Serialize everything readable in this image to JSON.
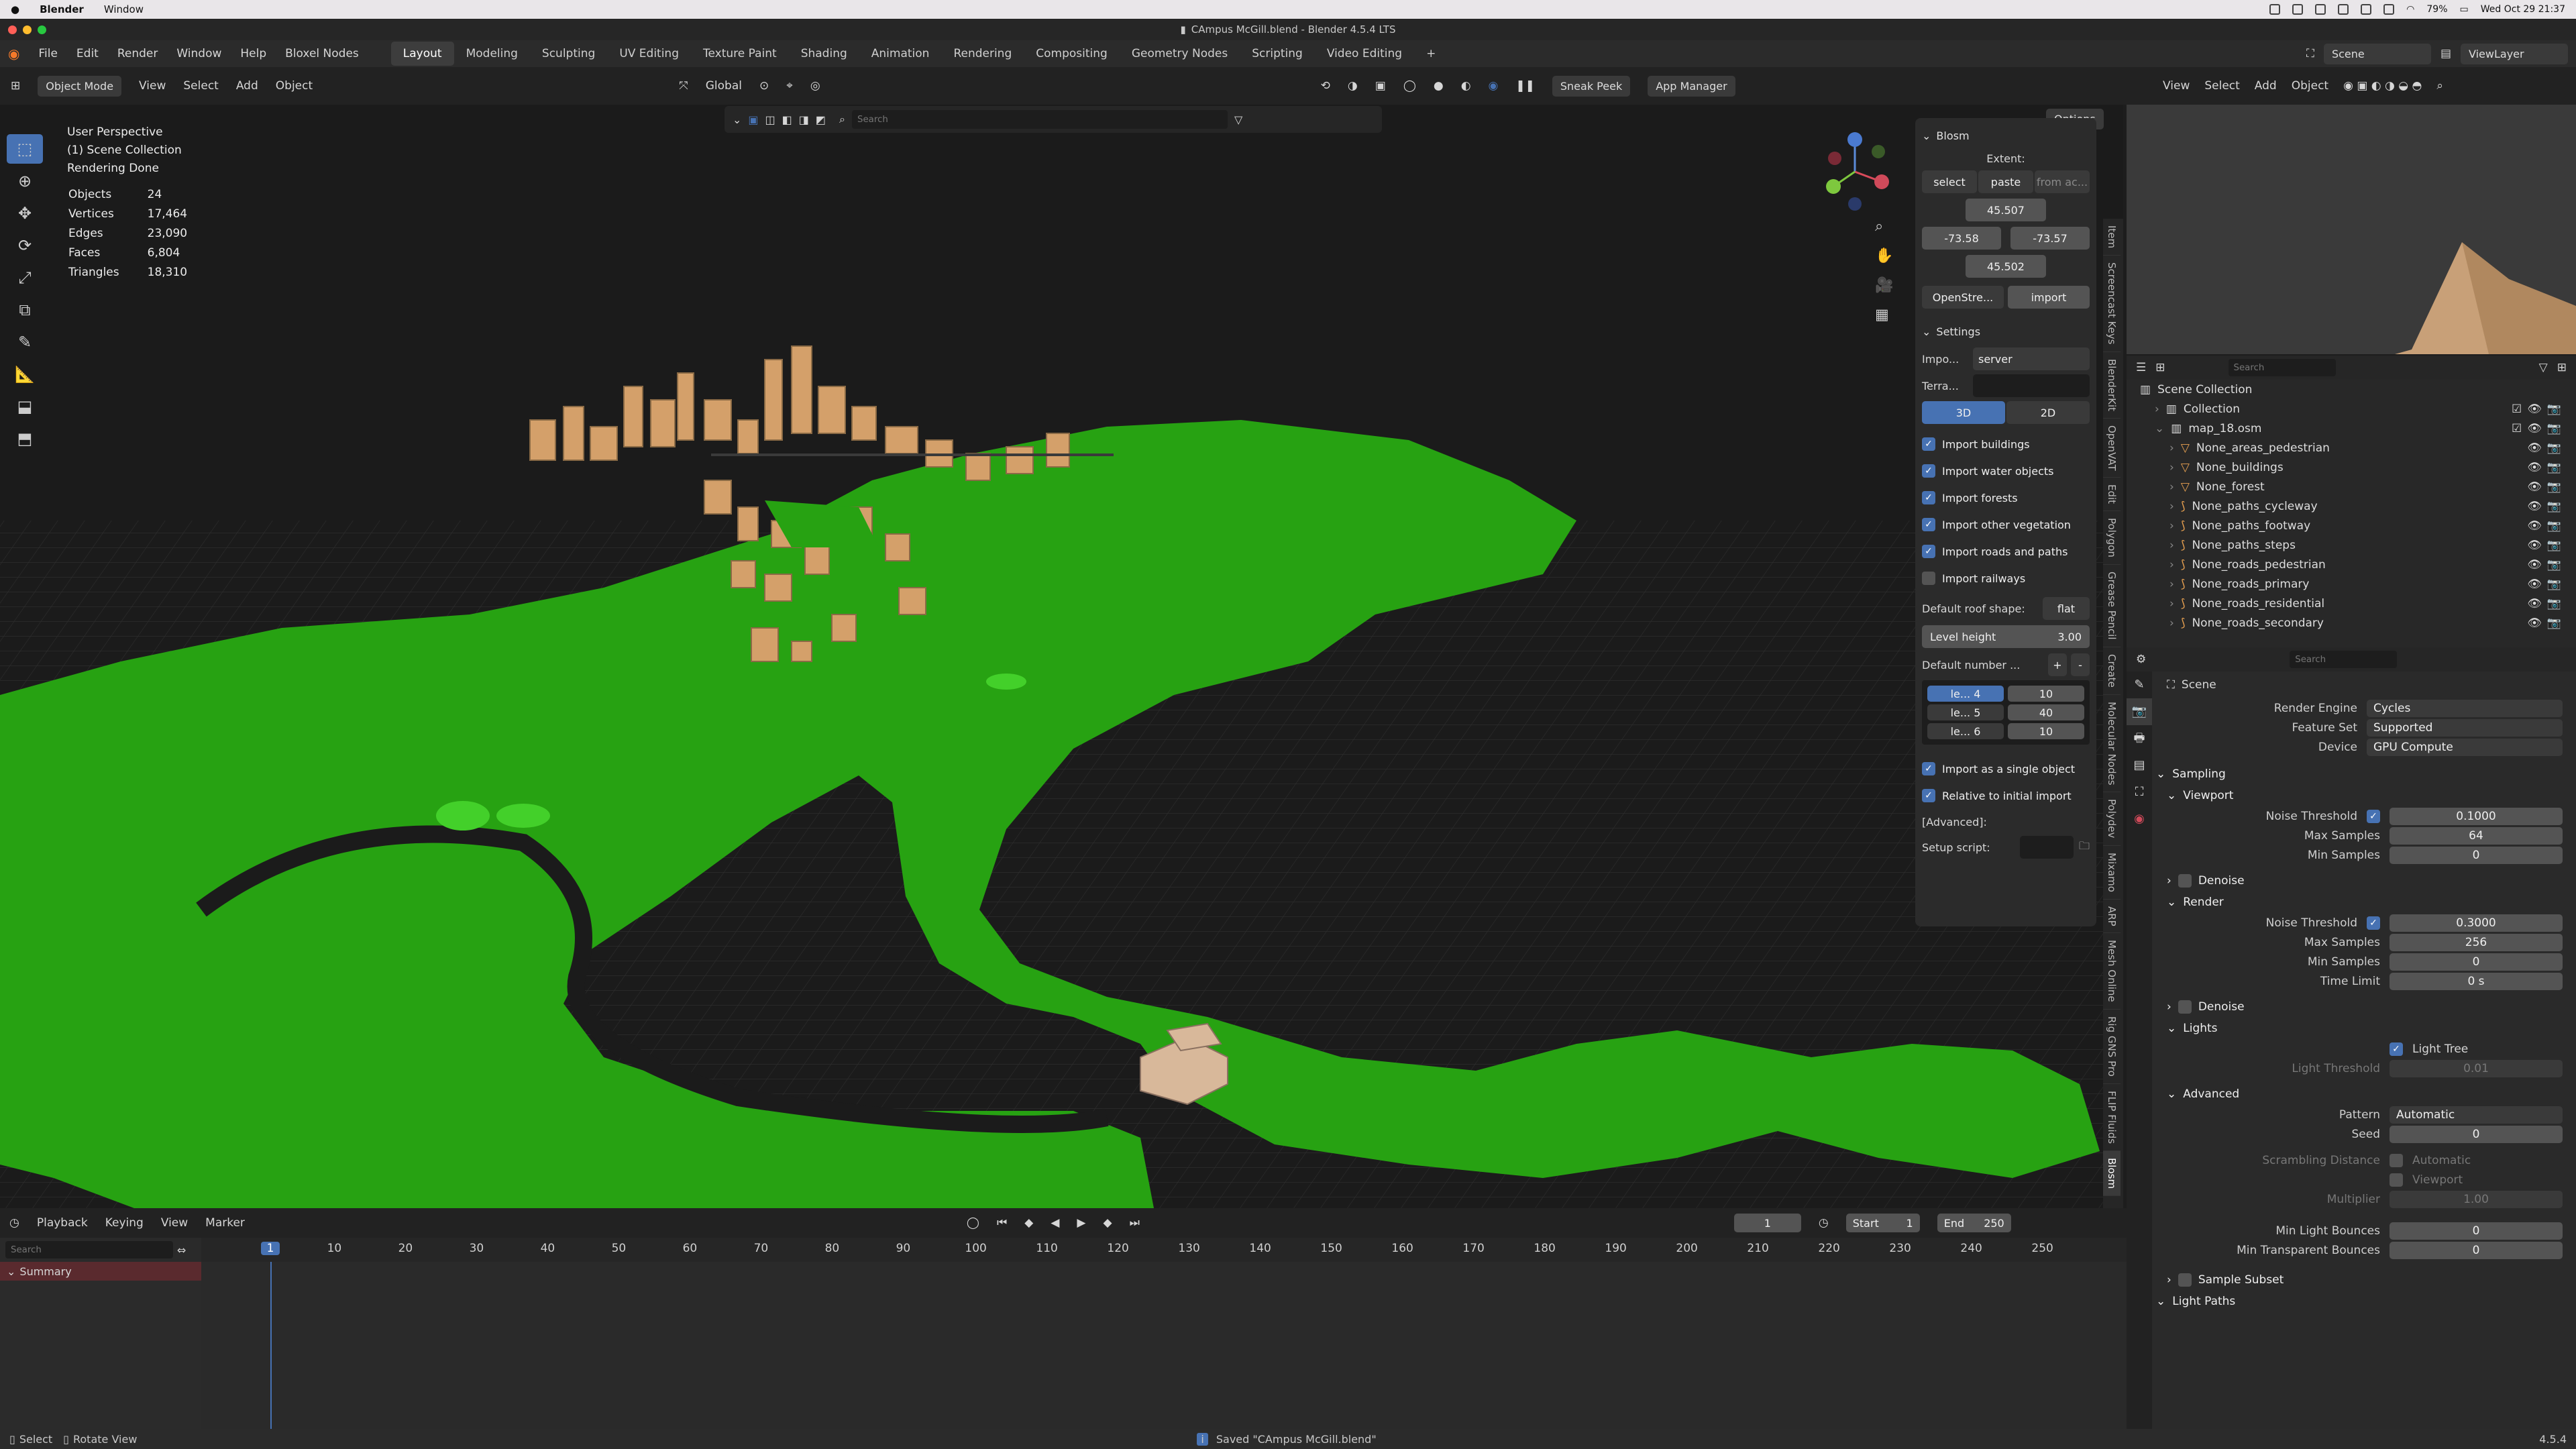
{
  "mac": {
    "app": "Blender",
    "menu": "Window",
    "clock": "Wed Oct 29 21:37",
    "battery": "79%"
  },
  "window_title": "CAmpus McGill.blend - Blender 4.5.4 LTS",
  "top_menu": [
    "File",
    "Edit",
    "Render",
    "Window",
    "Help",
    "Bloxel Nodes"
  ],
  "workspaces": [
    "Layout",
    "Modeling",
    "Sculpting",
    "UV Editing",
    "Texture Paint",
    "Shading",
    "Animation",
    "Rendering",
    "Compositing",
    "Geometry Nodes",
    "Scripting",
    "Video Editing"
  ],
  "active_workspace": "Layout",
  "scene_label": "Scene",
  "viewlayer_label": "ViewLayer",
  "viewport_header": {
    "mode": "Object Mode",
    "menus": [
      "View",
      "Select",
      "Add",
      "Object"
    ],
    "orientation": "Global",
    "sneak_peek": "Sneak Peek",
    "app_manager": "App Manager",
    "options": "Options",
    "search_placeholder": "Search"
  },
  "overlay": {
    "line1": "User Perspective",
    "line2": "(1) Scene Collection",
    "line3": "Rendering Done",
    "stats": [
      [
        "Objects",
        "24"
      ],
      [
        "Vertices",
        "17,464"
      ],
      [
        "Edges",
        "23,090"
      ],
      [
        "Faces",
        "6,804"
      ],
      [
        "Triangles",
        "18,310"
      ]
    ]
  },
  "blosm": {
    "title": "Blosm",
    "extent_label": "Extent:",
    "select": "select",
    "paste": "paste",
    "from_active": "from ac...",
    "north": "45.507",
    "west": "-73.58",
    "east": "-73.57",
    "south": "45.502",
    "source": "OpenStre...",
    "import": "import"
  },
  "settings": {
    "title": "Settings",
    "import_label": "Impo...",
    "import_value": "server",
    "terrain_label": "Terra...",
    "mode_3d": "3D",
    "mode_2d": "2D",
    "checks": [
      {
        "label": "Import buildings",
        "on": true
      },
      {
        "label": "Import water objects",
        "on": true
      },
      {
        "label": "Import forests",
        "on": true
      },
      {
        "label": "Import other vegetation",
        "on": true
      },
      {
        "label": "Import roads and paths",
        "on": true
      },
      {
        "label": "Import railways",
        "on": false
      }
    ],
    "roof_label": "Default roof shape:",
    "roof_value": "flat",
    "level_label": "Level height",
    "level_value": "3.00",
    "default_number": "Default number ...",
    "levels": [
      [
        "le... 4",
        "10"
      ],
      [
        "le... 5",
        "40"
      ],
      [
        "le... 6",
        "10"
      ]
    ],
    "single_object": "Import as a single object",
    "relative": "Relative to initial import",
    "advanced": "[Advanced]:",
    "setup_script": "Setup script:"
  },
  "side_tabs": [
    "Item",
    "Screencast Keys",
    "BlenderKit",
    "OpenVAT",
    "Edit",
    "Polygon",
    "Grease Pencil",
    "Create",
    "Molecular Nodes",
    "Polydev",
    "Mixamo",
    "ARP",
    "Mesh Online",
    "Rig GNS Pro",
    "FLIP Fluids",
    "Blosm"
  ],
  "right_header": {
    "menus": [
      "View",
      "Select",
      "Add",
      "Object"
    ]
  },
  "outliner": {
    "search_placeholder": "Search",
    "root": "Scene Collection",
    "items": [
      {
        "name": "Collection",
        "indent": 1,
        "icon": "collection"
      },
      {
        "name": "map_18.osm",
        "indent": 1,
        "icon": "collection"
      },
      {
        "name": "None_areas_pedestrian",
        "indent": 2,
        "icon": "mesh"
      },
      {
        "name": "None_buildings",
        "indent": 2,
        "icon": "mesh"
      },
      {
        "name": "None_forest",
        "indent": 2,
        "icon": "mesh"
      },
      {
        "name": "None_paths_cycleway",
        "indent": 2,
        "icon": "curve"
      },
      {
        "name": "None_paths_footway",
        "indent": 2,
        "icon": "curve"
      },
      {
        "name": "None_paths_steps",
        "indent": 2,
        "icon": "curve"
      },
      {
        "name": "None_roads_pedestrian",
        "indent": 2,
        "icon": "curve"
      },
      {
        "name": "None_roads_primary",
        "indent": 2,
        "icon": "curve"
      },
      {
        "name": "None_roads_residential",
        "indent": 2,
        "icon": "curve"
      },
      {
        "name": "None_roads_secondary",
        "indent": 2,
        "icon": "curve"
      }
    ]
  },
  "properties": {
    "search_placeholder": "Search",
    "scene": "Scene",
    "render_engine": [
      "Render Engine",
      "Cycles"
    ],
    "feature_set": [
      "Feature Set",
      "Supported"
    ],
    "device": [
      "Device",
      "GPU Compute"
    ],
    "sampling": "Sampling",
    "viewport": "Viewport",
    "vp_rows": [
      [
        "Noise Threshold",
        "0.1000"
      ],
      [
        "Max Samples",
        "64"
      ],
      [
        "Min Samples",
        "0"
      ]
    ],
    "denoise": "Denoise",
    "render": "Render",
    "r_rows": [
      [
        "Noise Threshold",
        "0.3000"
      ],
      [
        "Max Samples",
        "256"
      ],
      [
        "Min Samples",
        "0"
      ],
      [
        "Time Limit",
        "0 s"
      ]
    ],
    "lights": "Lights",
    "light_tree": "Light Tree",
    "light_threshold": [
      "Light Threshold",
      "0.01"
    ],
    "advanced": "Advanced",
    "pattern": [
      "Pattern",
      "Automatic"
    ],
    "seed": [
      "Seed",
      "0"
    ],
    "scrambling": "Scrambling Distance",
    "automatic": "Automatic",
    "viewport_chk": "Viewport",
    "multiplier": [
      "Multiplier",
      "1.00"
    ],
    "min_light_bounces": [
      "Min Light Bounces",
      "0"
    ],
    "min_transp_bounces": [
      "Min Transparent Bounces",
      "0"
    ],
    "sample_subset": "Sample Subset",
    "light_paths": "Light Paths"
  },
  "timeline": {
    "menus": [
      "Playback",
      "Keying",
      "View",
      "Marker"
    ],
    "current": "1",
    "start_label": "Start",
    "start": "1",
    "end_label": "End",
    "end": "250",
    "search_placeholder": "Search",
    "summary": "Summary",
    "ticks": [
      "1",
      "10",
      "20",
      "30",
      "40",
      "50",
      "60",
      "70",
      "80",
      "90",
      "100",
      "110",
      "120",
      "130",
      "140",
      "150",
      "160",
      "170",
      "180",
      "190",
      "200",
      "210",
      "220",
      "230",
      "240",
      "250"
    ]
  },
  "status": {
    "select": "Select",
    "rotate": "Rotate View",
    "message": "Saved \"CAmpus McGill.blend\"",
    "version": "4.5.4"
  }
}
